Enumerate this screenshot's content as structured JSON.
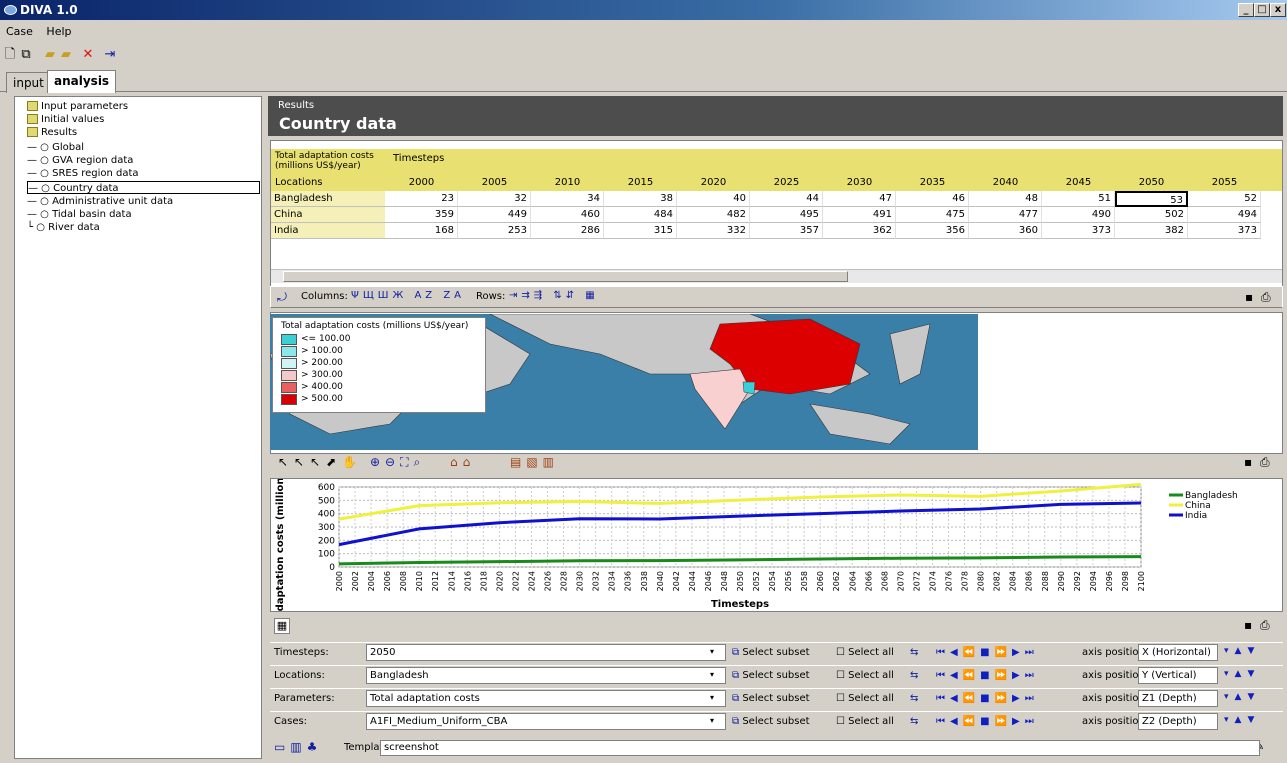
{
  "window": {
    "title": "DIVA 1.0",
    "controls": [
      "_",
      "□",
      "x"
    ]
  },
  "menu": [
    "Case",
    "Help"
  ],
  "toolbar_icons": [
    "new-icon",
    "copy-icon",
    "open-icon",
    "open-folder-icon",
    "delete-icon",
    "exit-icon"
  ],
  "tabs": [
    {
      "label": "input"
    },
    {
      "label": "analysis"
    }
  ],
  "tree": {
    "items": [
      {
        "label": "Input parameters",
        "level": 0,
        "folder": true
      },
      {
        "label": "Initial values",
        "level": 0,
        "folder": true
      },
      {
        "label": "Results",
        "level": 0,
        "folder": true
      },
      {
        "label": "Global",
        "level": 1
      },
      {
        "label": "GVA region data",
        "level": 1
      },
      {
        "label": "SRES region data",
        "level": 1
      },
      {
        "label": "Country data",
        "level": 1,
        "selected": true
      },
      {
        "label": "Administrative unit data",
        "level": 1
      },
      {
        "label": "Tidal basin data",
        "level": 1
      },
      {
        "label": "River data",
        "level": 1
      }
    ]
  },
  "header": {
    "small": "Results",
    "title": "Country data"
  },
  "grid": {
    "param_label": "Total adaptation costs (millions US$/year)",
    "timesteps_label": "Timesteps",
    "locations_label": "Locations",
    "columns": [
      "2000",
      "2005",
      "2010",
      "2015",
      "2020",
      "2025",
      "2030",
      "2035",
      "2040",
      "2045",
      "2050",
      "2055"
    ],
    "rows": [
      {
        "name": "Bangladesh",
        "values": [
          "23",
          "32",
          "34",
          "38",
          "40",
          "44",
          "47",
          "46",
          "48",
          "51",
          "53",
          "52"
        ]
      },
      {
        "name": "China",
        "values": [
          "359",
          "449",
          "460",
          "484",
          "482",
          "495",
          "491",
          "475",
          "477",
          "490",
          "502",
          "494"
        ]
      },
      {
        "name": "India",
        "values": [
          "168",
          "253",
          "286",
          "315",
          "332",
          "357",
          "362",
          "356",
          "360",
          "373",
          "382",
          "373"
        ]
      }
    ]
  },
  "gridtools": {
    "columns_label": "Columns:",
    "rows_label": "Rows:"
  },
  "legend": {
    "title": "Total adaptation costs (millions US$/year)",
    "items": [
      {
        "label": "<= 100.00",
        "color": "#3ad0d8"
      },
      {
        "label": "> 100.00",
        "color": "#8ae8ec"
      },
      {
        "label": "> 200.00",
        "color": "#d0f4f4"
      },
      {
        "label": "> 300.00",
        "color": "#f4c8c8"
      },
      {
        "label": "> 400.00",
        "color": "#e86060"
      },
      {
        "label": "> 500.00",
        "color": "#d80000"
      }
    ]
  },
  "chart_data": {
    "type": "line",
    "xlabel": "Timesteps",
    "ylabel": "tal adaptation costs (million",
    "ylim": [
      0,
      600
    ],
    "yticks": [
      0,
      100,
      200,
      300,
      400,
      500,
      600
    ],
    "x": [
      2000,
      2010,
      2020,
      2030,
      2040,
      2050,
      2060,
      2070,
      2080,
      2090,
      2100
    ],
    "xticks": [
      "2000",
      "2002",
      "2004",
      "2006",
      "2008",
      "2010",
      "2012",
      "2014",
      "2016",
      "2018",
      "2020",
      "2022",
      "2024",
      "2026",
      "2028",
      "2030",
      "2032",
      "2034",
      "2036",
      "2038",
      "2040",
      "2042",
      "2044",
      "2046",
      "2048",
      "2050",
      "2052",
      "2054",
      "2056",
      "2058",
      "2060",
      "2062",
      "2064",
      "2066",
      "2068",
      "2070",
      "2072",
      "2074",
      "2076",
      "2078",
      "2080",
      "2082",
      "2084",
      "2086",
      "2088",
      "2090",
      "2092",
      "2094",
      "2096",
      "2098",
      "2100"
    ],
    "series": [
      {
        "name": "Bangladesh",
        "color": "#1a8a1a",
        "values": [
          23,
          34,
          40,
          47,
          48,
          53,
          60,
          66,
          68,
          75,
          78
        ]
      },
      {
        "name": "China",
        "color": "#f0f040",
        "values": [
          359,
          460,
          482,
          491,
          477,
          502,
          525,
          540,
          530,
          570,
          620
        ]
      },
      {
        "name": "India",
        "color": "#1010d0",
        "values": [
          168,
          286,
          332,
          362,
          360,
          382,
          400,
          420,
          435,
          470,
          480
        ]
      }
    ]
  },
  "controls": [
    {
      "label": "Timesteps:",
      "value": "2050",
      "axis": "X (Horizontal)"
    },
    {
      "label": "Locations:",
      "value": "Bangladesh",
      "axis": "Y (Vertical)"
    },
    {
      "label": "Parameters:",
      "value": "Total adaptation costs",
      "axis": "Z1 (Depth)"
    },
    {
      "label": "Cases:",
      "value": "A1FI_Medium_Uniform_CBA",
      "axis": "Z2 (Depth)"
    }
  ],
  "control_buttons": {
    "subset": "Select subset",
    "all": "Select all",
    "axis_position": "axis position:"
  },
  "template": {
    "label": "Template:",
    "value": "screenshot"
  }
}
